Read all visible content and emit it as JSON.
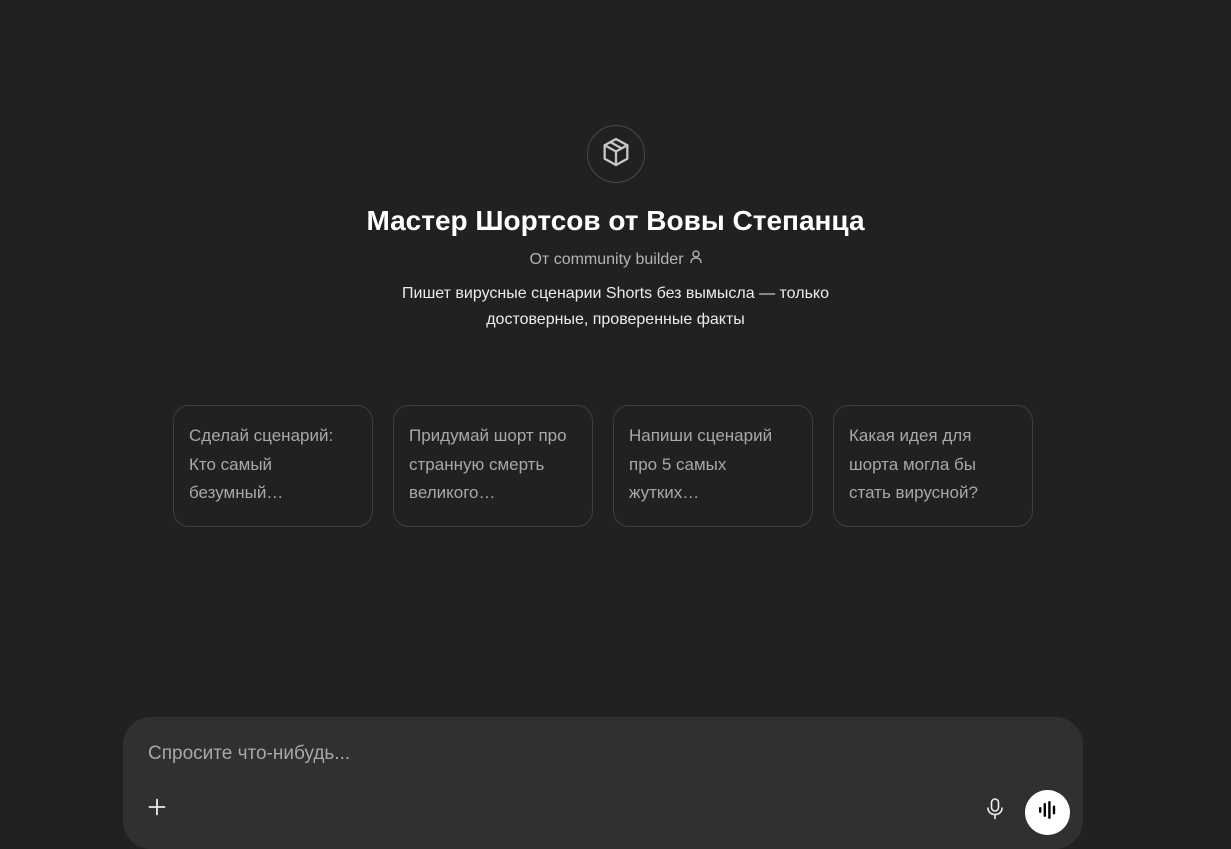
{
  "gpt": {
    "icon": "cube-icon",
    "title": "Мастер Шортсов от Вовы Степанца",
    "author": "От community builder",
    "author_icon": "person-icon",
    "description": "Пишет вирусные сценарии Shorts без вымысла — только достоверные, проверенные факты"
  },
  "starters": [
    {
      "text": "Сделай сценарий: Кто самый безумный…"
    },
    {
      "text": "Придумай шорт про странную смерть великого…"
    },
    {
      "text": "Напиши сценарий про 5 самых жутких…"
    },
    {
      "text": "Какая идея для шорта могла бы стать вирусной?"
    }
  ],
  "composer": {
    "placeholder": "Спросите что-нибудь...",
    "value": "",
    "attach_icon": "plus-icon",
    "dictate_icon": "microphone-icon",
    "voice_icon": "voice-mode-icon"
  },
  "colors": {
    "background": "#212121",
    "composer": "#303030",
    "card_border": "#3f3f3f",
    "voice_button": "#ffffff"
  }
}
